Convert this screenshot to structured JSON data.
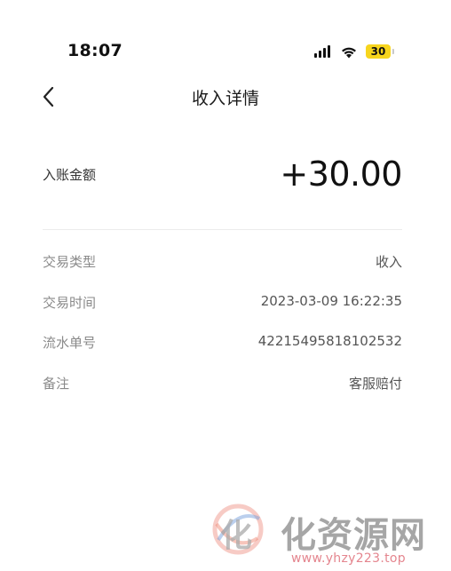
{
  "status_bar": {
    "time": "18:07",
    "battery": "30",
    "icons": [
      "signal-icon",
      "wifi-icon",
      "battery-icon"
    ],
    "battery_color": "#f7d51d"
  },
  "nav": {
    "back_icon": "chevron-left-icon",
    "title": "收入详情"
  },
  "amount": {
    "label": "入账金额",
    "value": "+30.00"
  },
  "details": [
    {
      "label": "交易类型",
      "value": "收入"
    },
    {
      "label": "交易时间",
      "value": "2023-03-09 16:22:35"
    },
    {
      "label": "流水单号",
      "value": "42215495818102532"
    },
    {
      "label": "备注",
      "value": "客服赔付"
    }
  ],
  "watermark": {
    "logo_icon": "watermark-logo-icon",
    "logo_text": "化",
    "text": "化资源网",
    "url": "www.yhzy223.top"
  }
}
